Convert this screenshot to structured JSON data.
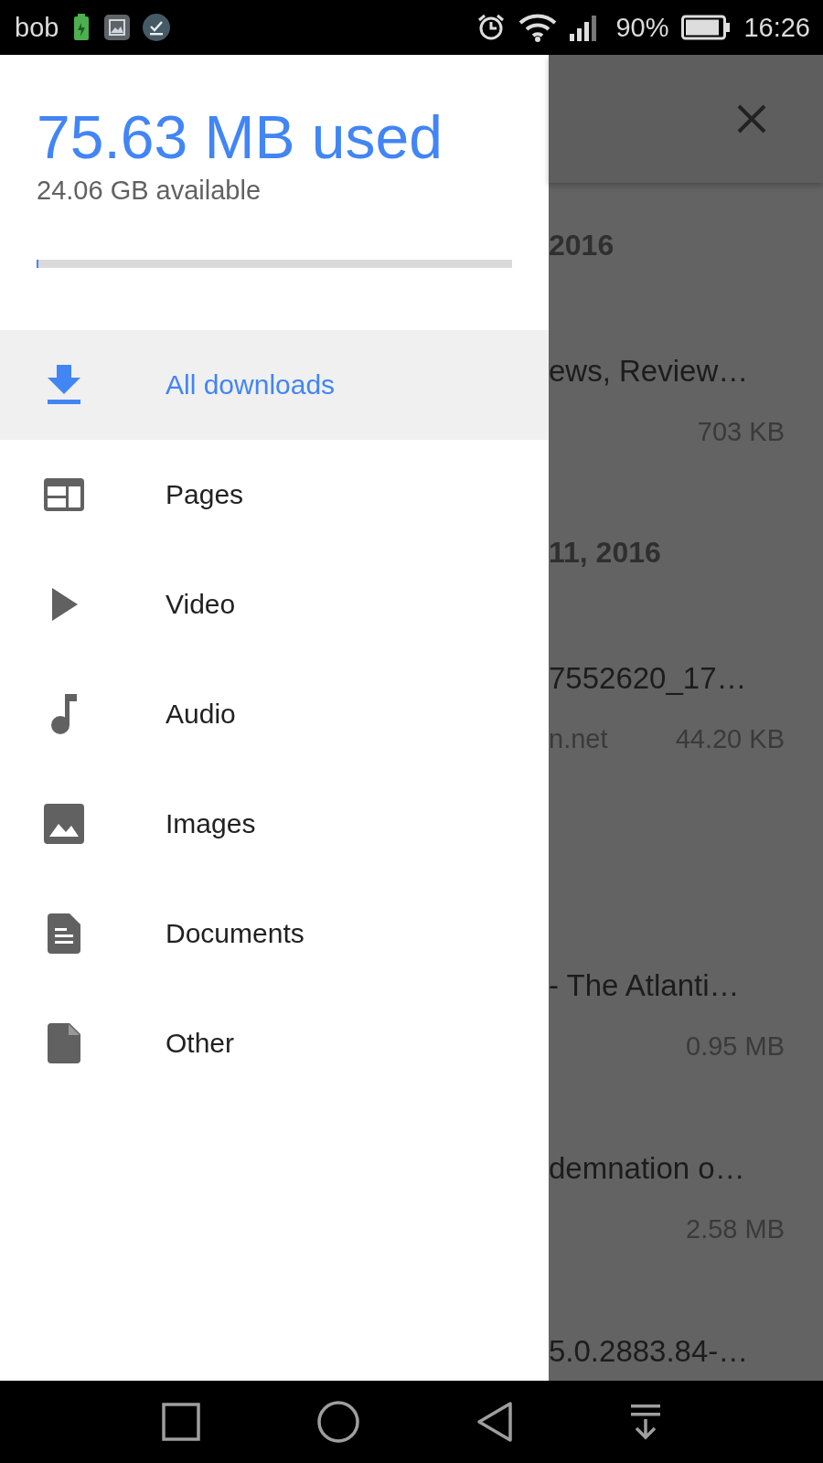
{
  "status_bar": {
    "carrier": "bob",
    "battery_percent": "90%",
    "time": "16:26"
  },
  "drawer": {
    "used": "75.63 MB used",
    "available": "24.06 GB available",
    "storage": {
      "level": 0.003
    },
    "items": [
      {
        "label": "All downloads",
        "kind": "download",
        "selected": true
      },
      {
        "label": "Pages",
        "kind": "pages",
        "selected": false
      },
      {
        "label": "Video",
        "kind": "video",
        "selected": false
      },
      {
        "label": "Audio",
        "kind": "audio",
        "selected": false
      },
      {
        "label": "Images",
        "kind": "images",
        "selected": false
      },
      {
        "label": "Documents",
        "kind": "documents",
        "selected": false
      },
      {
        "label": "Other",
        "kind": "other",
        "selected": false
      }
    ]
  },
  "background": {
    "sections": [
      {
        "date": "2016",
        "items": [
          {
            "title": "ews, Review…",
            "size": "703 KB"
          }
        ]
      },
      {
        "date": "11, 2016",
        "items": [
          {
            "title": "7552620_17…",
            "source": "n.net",
            "size": "44.20 KB"
          }
        ]
      },
      {
        "items": [
          {
            "title": "- The Atlanti…",
            "size": "0.95 MB"
          },
          {
            "title": "demnation o…",
            "size": "2.58 MB"
          },
          {
            "title": "5.0.2883.84-…"
          }
        ]
      }
    ]
  }
}
